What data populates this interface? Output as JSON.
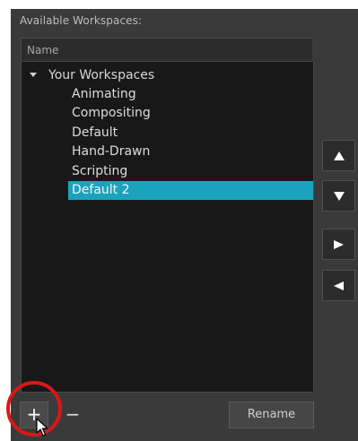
{
  "panel": {
    "label": "Available Workspaces:"
  },
  "tree": {
    "header": "Name",
    "root": "Your Workspaces",
    "items": [
      "Animating",
      "Compositing",
      "Default",
      "Hand-Drawn",
      "Scripting",
      "Default 2"
    ],
    "selected_index": 5
  },
  "buttons": {
    "add_label": "+",
    "remove_label": "−",
    "rename_label": "Rename"
  },
  "side_buttons": [
    "move-up",
    "move-down",
    "add-to-list",
    "remove-from-list"
  ],
  "colors": {
    "panel_bg": "#3a3a3a",
    "list_bg": "#181818",
    "selection": "#1ba3be",
    "highlight_ring": "#d81818"
  }
}
